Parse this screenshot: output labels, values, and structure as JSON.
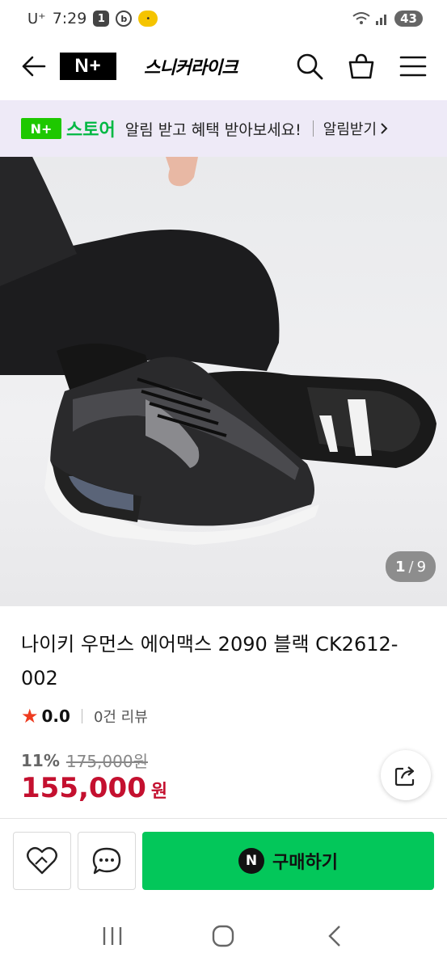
{
  "status_bar": {
    "carrier": "U⁺",
    "time": "7:29",
    "notif_badge": "1",
    "notif_b": "b",
    "battery": "43"
  },
  "nav": {
    "brand_logo": "N+",
    "store_name": "스니커라이크"
  },
  "banner": {
    "logo": "N+",
    "store": "스토어",
    "message": "알림 받고 혜택 받아보세요!",
    "action": "알림받기"
  },
  "gallery": {
    "current": "1",
    "separator": "/",
    "total": "9"
  },
  "product": {
    "title": "나이키 우먼스 에어맥스 2090 블랙 CK2612-002",
    "rating": "0.0",
    "review_count": "0건 리뷰",
    "discount": "11%",
    "original_price": "175,000원",
    "price": "155,000",
    "currency": "원"
  },
  "actions": {
    "buy_icon": "N",
    "buy_label": "구매하기"
  },
  "colors": {
    "accent_green": "#03c75a",
    "price_red": "#c4102f",
    "star": "#ee3b1f",
    "banner_bg": "#eeeaf7"
  },
  "icons": [
    "back-arrow-icon",
    "search-icon",
    "basket-icon",
    "menu-icon",
    "chevron-right-icon",
    "share-icon",
    "heart-icon",
    "chat-icon",
    "recent-apps-icon",
    "home-icon",
    "back-icon"
  ]
}
